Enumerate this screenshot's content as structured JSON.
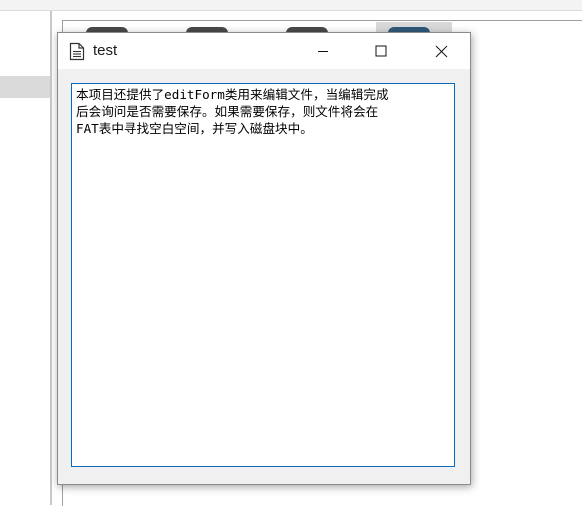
{
  "window": {
    "title": "test",
    "icon": "document-icon"
  },
  "caption_buttons": {
    "minimize": "minimize-icon",
    "maximize": "maximize-icon",
    "close": "close-icon"
  },
  "editor": {
    "content": "本项目还提供了editForm类用来编辑文件，当编辑完成\n后会询问是否需要保存。如果需要保存，则文件将会在\nFAT表中寻找空白空间，并写入磁盘块中。"
  },
  "colors": {
    "editor_border": "#0b6ab8",
    "window_bg": "#f0f0f0",
    "titlebar_bg": "#ffffff"
  }
}
